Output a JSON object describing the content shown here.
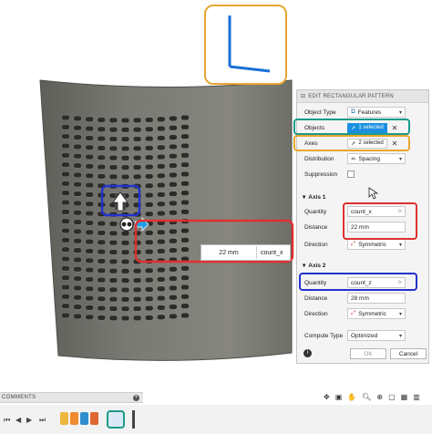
{
  "panel": {
    "title": "EDIT RECTANGULAR PATTERN",
    "object_type": {
      "label": "Object Type",
      "value": "Features"
    },
    "objects": {
      "label": "Objects",
      "value": "1 selected"
    },
    "axes": {
      "label": "Axes",
      "value": "2 selected"
    },
    "distribution": {
      "label": "Distribution",
      "value": "Spacing"
    },
    "suppression": {
      "label": "Suppression"
    },
    "axis1": {
      "title": "Axis 1",
      "quantity": {
        "label": "Quantity",
        "value": "count_x"
      },
      "distance": {
        "label": "Distance",
        "value": "22 mm"
      },
      "direction": {
        "label": "Direction",
        "value": "Symmetric"
      }
    },
    "axis2": {
      "title": "Axis 2",
      "quantity": {
        "label": "Quantity",
        "value": "count_z"
      },
      "distance": {
        "label": "Distance",
        "value": "28 mm"
      },
      "direction": {
        "label": "Direction",
        "value": "Symmetric"
      }
    },
    "compute_type": {
      "label": "Compute Type",
      "value": "Optimized"
    },
    "ok_label": "OK",
    "cancel_label": "Cancel",
    "fx_label": "fx"
  },
  "floating_input": {
    "distance": "22 mm",
    "parameter": "count_x"
  },
  "comments": {
    "label": "COMMENTS"
  },
  "colors": {
    "objects_highlight": "#1a9b8a",
    "axes_highlight": "#e8a630",
    "axis1_highlight": "#e03030",
    "axis2_highlight": "#2233cc",
    "selection_blue": "#1b8fe0",
    "model_surface": "#757570"
  },
  "icons": [
    "features-icon",
    "cursor-icon",
    "close-icon",
    "spacing-icon",
    "symmetric-icon",
    "info-icon",
    "move-arrow-icon",
    "orbit-icon",
    "pan-icon",
    "zoom-icon",
    "play-icon",
    "pattern-feature-icon"
  ]
}
